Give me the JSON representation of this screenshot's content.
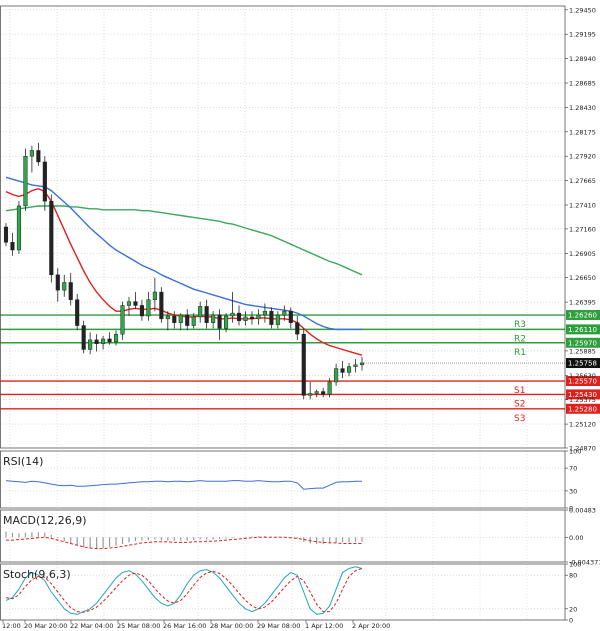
{
  "chart_data": {
    "type": "candlestick",
    "y_ticks": [
      "1.29450",
      "1.29195",
      "1.28940",
      "1.28685",
      "1.28430",
      "1.28175",
      "1.27920",
      "1.27665",
      "1.27410",
      "1.27160",
      "1.26905",
      "1.26650",
      "1.26395",
      "1.25885",
      "1.25630",
      "1.25375",
      "1.25120",
      "1.24870"
    ],
    "ylim": [
      1.2487,
      1.2949
    ],
    "x_ticks": [
      "12:00",
      "20 Mar 20:00",
      "22 Mar 04:00",
      "25 Mar 08:00",
      "26 Mar 16:00",
      "28 Mar 00:00",
      "29 Mar 08:00",
      "1 Apr 12:00",
      "2 Apr 20:00"
    ],
    "last_price": "1.25758",
    "levels": [
      {
        "name": "R3",
        "value": 1.2626,
        "label": "1.26260",
        "color": "#2e9e3e"
      },
      {
        "name": "R2",
        "value": 1.2611,
        "label": "1.26110",
        "color": "#2e9e3e"
      },
      {
        "name": "R1",
        "value": 1.2597,
        "label": "1.25970",
        "color": "#2e9e3e"
      },
      {
        "name": "S1",
        "value": 1.2557,
        "label": "1.25570",
        "color": "#e0201b"
      },
      {
        "name": "S2",
        "value": 1.2543,
        "label": "1.25430",
        "color": "#e0201b"
      },
      {
        "name": "S3",
        "value": 1.2528,
        "label": "1.25280",
        "color": "#e0201b"
      }
    ],
    "candles": [
      [
        1.2718,
        1.2722,
        1.2698,
        1.2702
      ],
      [
        1.2702,
        1.2712,
        1.2688,
        1.2694
      ],
      [
        1.2694,
        1.2745,
        1.269,
        1.274
      ],
      [
        1.274,
        1.28,
        1.2735,
        1.2792
      ],
      [
        1.2792,
        1.2803,
        1.2775,
        1.2798
      ],
      [
        1.2798,
        1.2806,
        1.2782,
        1.2786
      ],
      [
        1.2786,
        1.2792,
        1.2735,
        1.2745
      ],
      [
        1.2745,
        1.2752,
        1.266,
        1.2668
      ],
      [
        1.2668,
        1.2675,
        1.264,
        1.2652
      ],
      [
        1.2652,
        1.2668,
        1.2645,
        1.266
      ],
      [
        1.266,
        1.267,
        1.2636,
        1.2642
      ],
      [
        1.2642,
        1.2648,
        1.261,
        1.2615
      ],
      [
        1.2615,
        1.262,
        1.2586,
        1.259
      ],
      [
        1.259,
        1.2608,
        1.2585,
        1.26
      ],
      [
        1.26,
        1.2606,
        1.2588,
        1.2596
      ],
      [
        1.2596,
        1.2604,
        1.259,
        1.2601
      ],
      [
        1.2601,
        1.2608,
        1.2595,
        1.2598
      ],
      [
        1.2598,
        1.261,
        1.2594,
        1.2606
      ],
      [
        1.2606,
        1.264,
        1.26,
        1.2636
      ],
      [
        1.2636,
        1.2645,
        1.2625,
        1.264
      ],
      [
        1.264,
        1.265,
        1.2632,
        1.2636
      ],
      [
        1.2636,
        1.2642,
        1.262,
        1.2625
      ],
      [
        1.2625,
        1.265,
        1.262,
        1.2642
      ],
      [
        1.2642,
        1.2665,
        1.263,
        1.265
      ],
      [
        1.265,
        1.2655,
        1.2618,
        1.2622
      ],
      [
        1.2622,
        1.263,
        1.261,
        1.2625
      ],
      [
        1.2625,
        1.263,
        1.2612,
        1.2618
      ],
      [
        1.2618,
        1.2628,
        1.261,
        1.2626
      ],
      [
        1.2626,
        1.2632,
        1.261,
        1.2615
      ],
      [
        1.2615,
        1.2628,
        1.2612,
        1.2624
      ],
      [
        1.2624,
        1.264,
        1.2618,
        1.2635
      ],
      [
        1.2635,
        1.2642,
        1.2612,
        1.2618
      ],
      [
        1.2618,
        1.263,
        1.2612,
        1.2626
      ],
      [
        1.2626,
        1.2632,
        1.26,
        1.2612
      ],
      [
        1.2612,
        1.2628,
        1.2608,
        1.2625
      ],
      [
        1.2625,
        1.265,
        1.2618,
        1.2628
      ],
      [
        1.2628,
        1.2636,
        1.2615,
        1.262
      ],
      [
        1.262,
        1.263,
        1.2615,
        1.2624
      ],
      [
        1.2624,
        1.263,
        1.2616,
        1.2622
      ],
      [
        1.2622,
        1.2632,
        1.2616,
        1.2626
      ],
      [
        1.2626,
        1.2638,
        1.2618,
        1.263
      ],
      [
        1.263,
        1.2634,
        1.2612,
        1.2616
      ],
      [
        1.2616,
        1.263,
        1.2612,
        1.2626
      ],
      [
        1.2626,
        1.2636,
        1.262,
        1.263
      ],
      [
        1.263,
        1.2634,
        1.2612,
        1.2618
      ],
      [
        1.2618,
        1.2625,
        1.26,
        1.2606
      ],
      [
        1.2606,
        1.2612,
        1.2538,
        1.2542
      ],
      [
        1.2542,
        1.2556,
        1.2538,
        1.2544
      ],
      [
        1.2544,
        1.2548,
        1.254,
        1.2546
      ],
      [
        1.2546,
        1.255,
        1.254,
        1.2543
      ],
      [
        1.2543,
        1.256,
        1.254,
        1.2556
      ],
      [
        1.2556,
        1.2575,
        1.2552,
        1.257
      ],
      [
        1.257,
        1.2578,
        1.256,
        1.2566
      ],
      [
        1.2566,
        1.2576,
        1.2562,
        1.2572
      ],
      [
        1.2572,
        1.258,
        1.2566,
        1.2574
      ],
      [
        1.2574,
        1.2582,
        1.2568,
        1.2576
      ]
    ],
    "ma_red": [
      1.2755,
      1.2752,
      1.275,
      1.2752,
      1.2756,
      1.2758,
      1.2755,
      1.2745,
      1.273,
      1.2715,
      1.27,
      1.2686,
      1.2672,
      1.266,
      1.265,
      1.2642,
      1.2635,
      1.263,
      1.263,
      1.2632,
      1.2633,
      1.2632,
      1.2632,
      1.2633,
      1.2631,
      1.2628,
      1.2626,
      1.2625,
      1.2624,
      1.2624,
      1.2625,
      1.2624,
      1.2624,
      1.2622,
      1.2622,
      1.2623,
      1.2622,
      1.2622,
      1.2622,
      1.2623,
      1.2623,
      1.2622,
      1.2622,
      1.2622,
      1.2621,
      1.2618,
      1.2612,
      1.2606,
      1.2601,
      1.2597,
      1.2594,
      1.2592,
      1.259,
      1.2588,
      1.2586,
      1.2584
    ],
    "ma_blue": [
      1.277,
      1.2768,
      1.2766,
      1.2764,
      1.2762,
      1.2761,
      1.276,
      1.2756,
      1.275,
      1.2744,
      1.2738,
      1.2731,
      1.2724,
      1.2717,
      1.2711,
      1.2705,
      1.2699,
      1.2694,
      1.269,
      1.2686,
      1.2682,
      1.2678,
      1.2675,
      1.2672,
      1.2668,
      1.2665,
      1.2662,
      1.2659,
      1.2656,
      1.2653,
      1.2651,
      1.2649,
      1.2647,
      1.2645,
      1.2643,
      1.2641,
      1.2639,
      1.2637,
      1.2636,
      1.2635,
      1.2634,
      1.2633,
      1.2632,
      1.2631,
      1.263,
      1.2628,
      1.2625,
      1.2621,
      1.2617,
      1.2614,
      1.2612,
      1.2611,
      1.2611,
      1.2611,
      1.2611,
      1.2611
    ],
    "ma_green": [
      1.2735,
      1.2736,
      1.2737,
      1.2738,
      1.2739,
      1.274,
      1.274,
      1.274,
      1.274,
      1.274,
      1.2739,
      1.2739,
      1.2738,
      1.2737,
      1.2737,
      1.2736,
      1.2736,
      1.2736,
      1.2736,
      1.2736,
      1.2736,
      1.2735,
      1.2735,
      1.2734,
      1.2733,
      1.2732,
      1.2731,
      1.273,
      1.2729,
      1.2728,
      1.2727,
      1.2726,
      1.2725,
      1.2724,
      1.2722,
      1.2721,
      1.2719,
      1.2717,
      1.2715,
      1.2713,
      1.2711,
      1.2709,
      1.2706,
      1.2703,
      1.27,
      1.2697,
      1.2694,
      1.2691,
      1.2688,
      1.2685,
      1.2682,
      1.268,
      1.2677,
      1.2674,
      1.2671,
      1.2668
    ],
    "indicators": [
      {
        "title": "RSI(14)",
        "ticks": [
          "100",
          "70",
          "30",
          "0"
        ],
        "range": [
          0,
          100
        ],
        "series": [
          {
            "color": "#3b6fd9",
            "dashed": false,
            "values": [
              48,
              47,
              46,
              45,
              47,
              46,
              44,
              42,
              40,
              39,
              40,
              38,
              38,
              39,
              40,
              41,
              42,
              42,
              43,
              44,
              45,
              46,
              46,
              47,
              47,
              46,
              47,
              47,
              46,
              47,
              48,
              47,
              47,
              47,
              47,
              48,
              48,
              47,
              47,
              48,
              47,
              46,
              46,
              47,
              47,
              44,
              33,
              34,
              35,
              35,
              40,
              45,
              46,
              46,
              47,
              47
            ]
          }
        ]
      },
      {
        "title": "MACD(12,26,9)",
        "ticks": [
          "0.00483",
          "0.00",
          "-0.004377"
        ],
        "range": [
          -0.004377,
          0.00483
        ],
        "series": [
          {
            "color": "#e0201b",
            "dashed": true,
            "values": [
              -0.0005,
              -0.0005,
              -0.0004,
              -0.0003,
              -0.0002,
              -0.0001,
              0.0,
              -0.0002,
              -0.0005,
              -0.0008,
              -0.0011,
              -0.0014,
              -0.0017,
              -0.0019,
              -0.002,
              -0.002,
              -0.0019,
              -0.0018,
              -0.0016,
              -0.0014,
              -0.0012,
              -0.001,
              -0.0009,
              -0.0008,
              -0.0008,
              -0.0008,
              -0.0009,
              -0.0009,
              -0.0009,
              -0.0008,
              -0.0008,
              -0.0007,
              -0.0007,
              -0.0006,
              -0.0005,
              -0.0004,
              -0.0003,
              -0.0002,
              -0.0001,
              0.0,
              0.0,
              0.0,
              0.0,
              0.0,
              -0.0001,
              -0.0002,
              -0.0004,
              -0.0006,
              -0.0008,
              -0.0009,
              -0.001,
              -0.001,
              -0.0011,
              -0.0011,
              -0.0011,
              -0.0011
            ]
          }
        ],
        "histogram": [
          0.001,
          0.0008,
          0.0007,
          0.0008,
          0.0009,
          0.0009,
          0.0008,
          0.0004,
          -0.0002,
          -0.0007,
          -0.0011,
          -0.0015,
          -0.0018,
          -0.002,
          -0.002,
          -0.0019,
          -0.0017,
          -0.0015,
          -0.0012,
          -0.0009,
          -0.0007,
          -0.0006,
          -0.0005,
          -0.0004,
          -0.0005,
          -0.0006,
          -0.0006,
          -0.0006,
          -0.0006,
          -0.0005,
          -0.0004,
          -0.0004,
          -0.0004,
          -0.0003,
          -0.0002,
          -0.0001,
          0.0,
          0.0001,
          0.0001,
          0.0002,
          0.0002,
          0.0001,
          0.0001,
          0.0001,
          0.0,
          -0.0002,
          -0.0008,
          -0.0011,
          -0.0012,
          -0.0012,
          -0.0011,
          -0.001,
          -0.0009,
          -0.0009,
          -0.0008,
          -0.0008
        ]
      },
      {
        "title": "Stoch(9,6,3)",
        "ticks": [
          "100",
          "80",
          "20",
          "0"
        ],
        "range": [
          0,
          100
        ],
        "series": [
          {
            "color": "#23a5b5",
            "dashed": false,
            "values": [
              35,
              40,
              55,
              75,
              85,
              80,
              70,
              50,
              35,
              20,
              12,
              10,
              15,
              20,
              30,
              45,
              60,
              75,
              85,
              88,
              82,
              70,
              55,
              40,
              30,
              25,
              30,
              45,
              65,
              80,
              88,
              90,
              85,
              75,
              60,
              45,
              30,
              20,
              15,
              20,
              30,
              45,
              60,
              75,
              85,
              80,
              50,
              20,
              10,
              12,
              25,
              55,
              85,
              92,
              95,
              92
            ]
          },
          {
            "color": "#e0201b",
            "dashed": true,
            "values": [
              40,
              38,
              45,
              60,
              72,
              78,
              76,
              65,
              50,
              35,
              22,
              15,
              14,
              17,
              23,
              33,
              45,
              58,
              70,
              80,
              84,
              80,
              70,
              56,
              44,
              34,
              30,
              35,
              47,
              62,
              76,
              84,
              87,
              83,
              74,
              62,
              48,
              35,
              25,
              20,
              23,
              32,
              45,
              58,
              70,
              78,
              70,
              50,
              28,
              15,
              15,
              30,
              55,
              78,
              88,
              92
            ]
          }
        ]
      }
    ]
  }
}
